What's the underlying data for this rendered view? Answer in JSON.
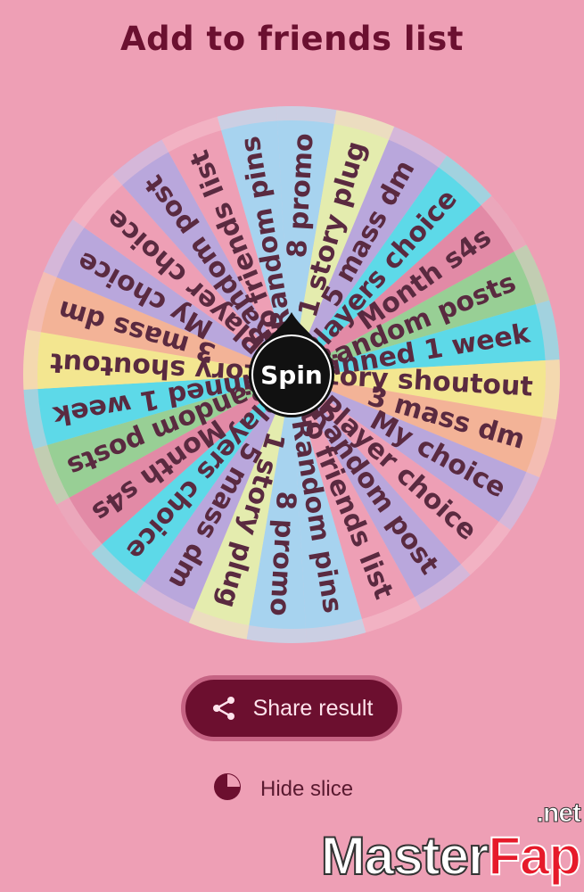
{
  "title": "Add to friends list",
  "wheel": {
    "center_label": "Spin",
    "slices": [
      {
        "label": "8 promo",
        "color": "#a7d3ef"
      },
      {
        "label": "1 story plug",
        "color": "#e4ecae"
      },
      {
        "label": "5 mass dm",
        "color": "#b9a7dc"
      },
      {
        "label": "Players choice",
        "color": "#5dd9e8"
      },
      {
        "label": "Month s4s",
        "color": "#e28aa6"
      },
      {
        "label": "Random posts",
        "color": "#98cf95"
      },
      {
        "label": "Pinned 1 week",
        "color": "#5dd9e8"
      },
      {
        "label": "Story shoutout",
        "color": "#f3e690"
      },
      {
        "label": "3 mass dm",
        "color": "#f3b397"
      },
      {
        "label": "My choice",
        "color": "#b9a7dc"
      },
      {
        "label": "Player choice",
        "color": "#ee9fb5"
      },
      {
        "label": "Random post",
        "color": "#b9a7dc"
      },
      {
        "label": "Add to friends list",
        "color": "#ee9fb5"
      },
      {
        "label": "Random pins",
        "color": "#a7d3ef"
      },
      {
        "label": "8 promo",
        "color": "#a7d3ef"
      },
      {
        "label": "1 story plug",
        "color": "#e4ecae"
      },
      {
        "label": "5 mass dm",
        "color": "#b9a7dc"
      },
      {
        "label": "Players choice",
        "color": "#5dd9e8"
      },
      {
        "label": "Month s4s",
        "color": "#e28aa6"
      },
      {
        "label": "Random posts",
        "color": "#98cf95"
      },
      {
        "label": "Pinned 1 week",
        "color": "#5dd9e8"
      },
      {
        "label": "Story shoutout",
        "color": "#f3e690"
      },
      {
        "label": "3 mass dm",
        "color": "#f3b397"
      },
      {
        "label": "My choice",
        "color": "#b9a7dc"
      },
      {
        "label": "Player choice",
        "color": "#ee9fb5"
      },
      {
        "label": "Random post",
        "color": "#b9a7dc"
      },
      {
        "label": "Add to friends list",
        "color": "#ee9fb5"
      },
      {
        "label": "Random pins",
        "color": "#a7d3ef"
      }
    ]
  },
  "actions": {
    "share_label": "Share result",
    "hide_slice_label": "Hide slice"
  },
  "watermark": {
    "master": "Master",
    "fap": "Fap",
    "net": ".net"
  },
  "icons": {
    "share": "share-icon",
    "hide_slice": "pie-slice-icon"
  },
  "colors": {
    "background": "#ee9fb5",
    "title": "#6b1030",
    "button": "#6c0f2f",
    "button_border": "#c56383",
    "slice_text": "#5a2a40"
  }
}
